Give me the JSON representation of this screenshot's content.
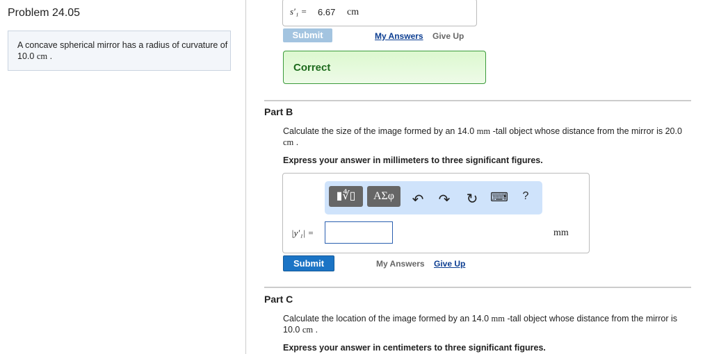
{
  "problem": {
    "title": "Problem 24.05",
    "statement_pre": "A concave spherical mirror has a radius of curvature of",
    "statement_val": "10.0",
    "statement_unit": "cm",
    "statement_end": "."
  },
  "partA": {
    "var": "s′₁ =",
    "value": "6.67",
    "unit": "cm",
    "submit": "Submit",
    "my_answers": "My Answers",
    "give_up": "Give Up",
    "feedback": "Correct"
  },
  "partB": {
    "title": "Part B",
    "q1": "Calculate the size of the image formed by an 14.0",
    "q_unit1": "mm",
    "q2": "-tall object whose distance from the mirror is",
    "q3": "20.0",
    "q_unit2": "cm",
    "q_end": ".",
    "instruction": "Express your answer in millimeters to three significant figures.",
    "toolbar": {
      "templates": "▮∜▯",
      "greek": "ΑΣφ",
      "undo": "↶",
      "redo": "↷",
      "reset": "↻",
      "keyboard": "⌨",
      "help": "?"
    },
    "var": "|y′₁| =",
    "value": "",
    "unit": "mm",
    "submit": "Submit",
    "my_answers": "My Answers",
    "give_up": "Give Up"
  },
  "partC": {
    "title": "Part C",
    "q1": "Calculate the location of the image formed by an 14.0",
    "q_unit1": "mm",
    "q2": "-tall object whose distance from the",
    "q3": "mirror is 10.0",
    "q_unit2": "cm",
    "q_end": ".",
    "instruction": "Express your answer in centimeters to three significant figures."
  }
}
